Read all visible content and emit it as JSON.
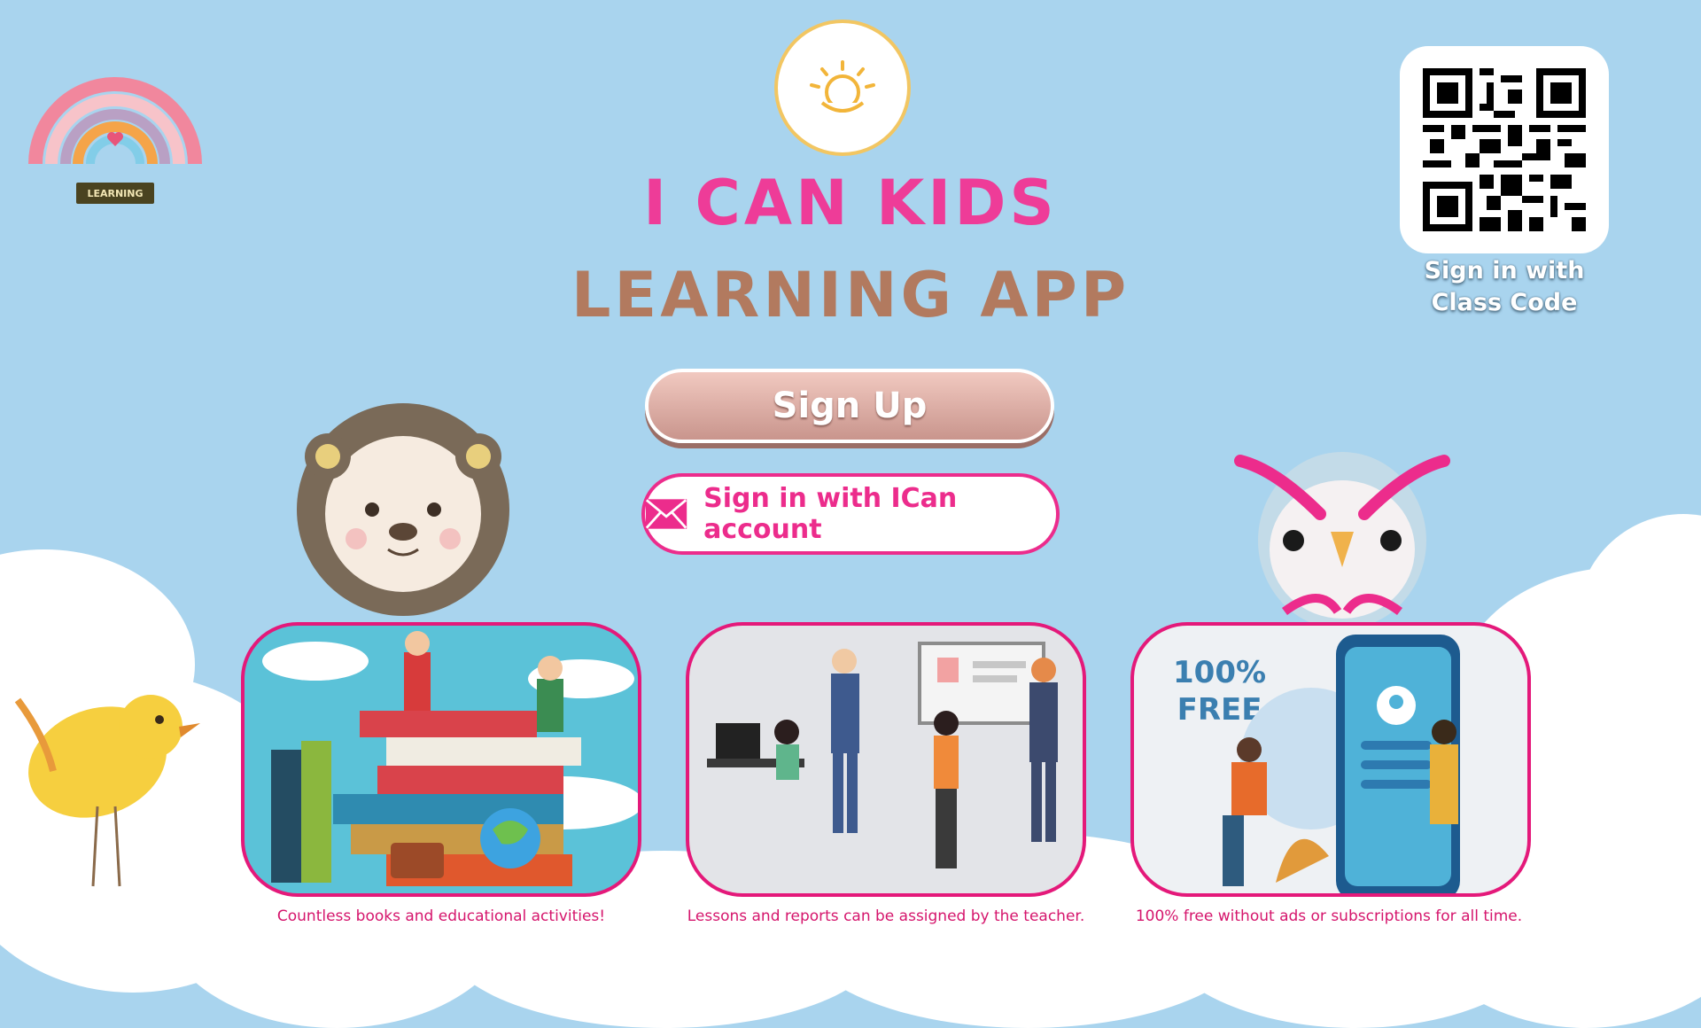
{
  "brand": {
    "logo_tag": "LEARNING"
  },
  "app": {
    "title_line1": "I CAN KIDS",
    "title_line2": "LEARNING APP",
    "logo_icon": "sun-hand-icon"
  },
  "actions": {
    "signup_label": "Sign Up",
    "signin_ican_label": "Sign in with ICan account",
    "signin_icon": "mail-icon"
  },
  "qr": {
    "label_line1": "Sign in with",
    "label_line2": "Class Code",
    "icon": "qr-code-icon"
  },
  "features": [
    {
      "caption": "Countless books and educational activities!"
    },
    {
      "caption": "Lessons and reports can be assigned by the teacher."
    },
    {
      "badge_line1": "100%",
      "badge_line2": "FREE",
      "caption": "100% free without ads or subscriptions for all time."
    }
  ],
  "colors": {
    "background": "#a9d4ee",
    "accent_pink": "#ec2c8c",
    "title_brown": "#b27a5f",
    "signup_pink": "#d8a49b"
  }
}
